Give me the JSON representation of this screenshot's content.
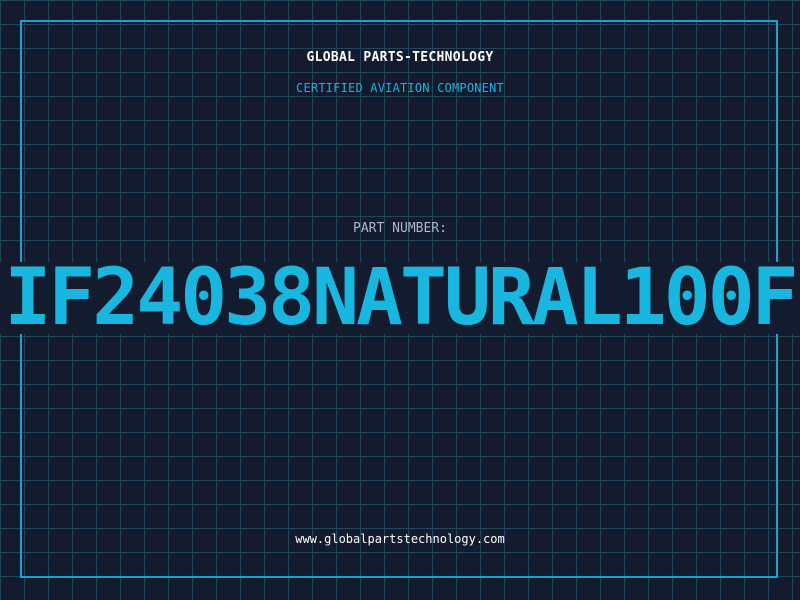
{
  "header": {
    "company": "GLOBAL PARTS-TECHNOLOGY",
    "subtitle": "CERTIFIED AVIATION COMPONENT"
  },
  "part": {
    "label": "PART NUMBER:",
    "number": "IF24038NATURAL100F"
  },
  "footer": {
    "url": "www.globalpartstechnology.com"
  },
  "colors": {
    "background": "#131b2e",
    "grid": "#1f4a63",
    "accent": "#19b7e0",
    "text_primary": "#ffffff",
    "text_muted": "#a9b8cc"
  }
}
